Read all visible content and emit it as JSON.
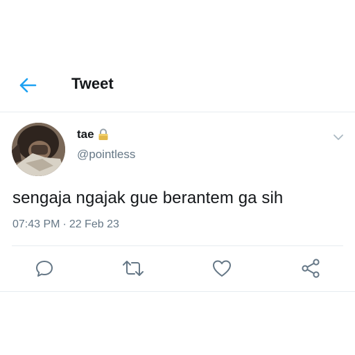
{
  "header": {
    "title": "Tweet",
    "back_icon": "arrow-left-icon",
    "accent_color": "#1da1f2"
  },
  "tweet": {
    "user": {
      "name": "tae",
      "handle": "@pointless",
      "protected_icon": "lock-icon"
    },
    "text": "sengaja ngajak gue berantem ga sih",
    "time": "07:43 PM",
    "separator": "·",
    "date": "22 Feb 23",
    "menu_icon": "chevron-down-icon"
  },
  "actions": [
    {
      "icon": "reply-icon"
    },
    {
      "icon": "retweet-icon"
    },
    {
      "icon": "like-icon"
    },
    {
      "icon": "share-icon"
    }
  ],
  "colors": {
    "text_primary": "#14171a",
    "text_secondary": "#657786",
    "icon_gray": "#657786",
    "divider": "#e6ecf0"
  }
}
